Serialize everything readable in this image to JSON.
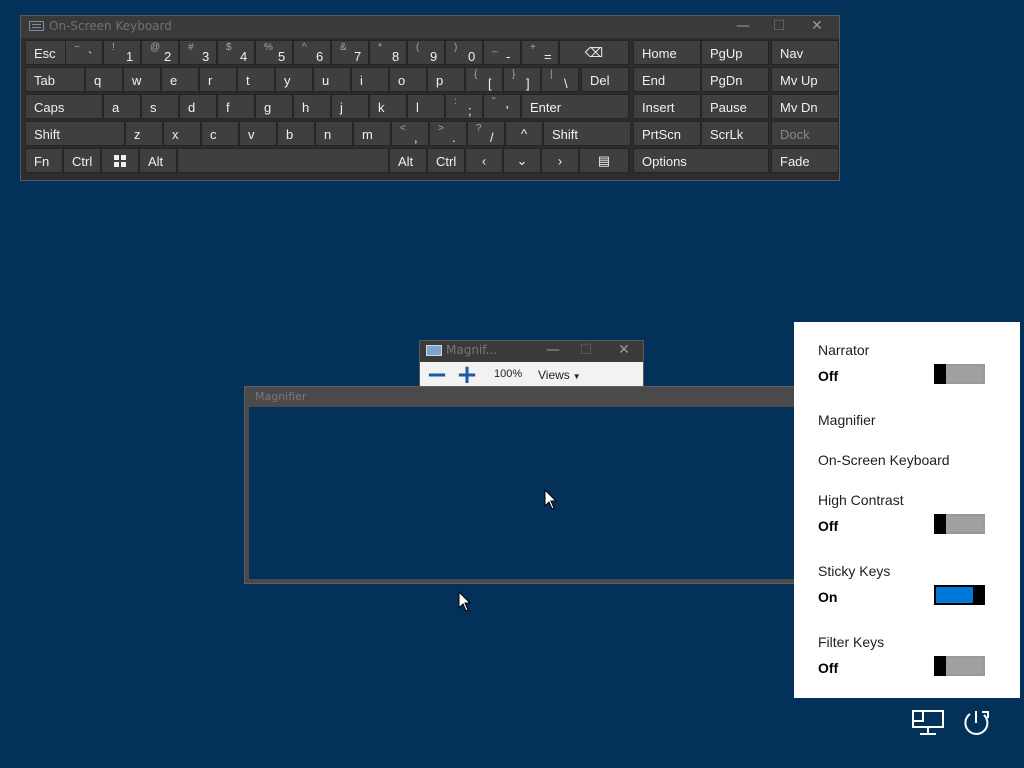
{
  "osk": {
    "title": "On-Screen Keyboard",
    "minimize": "—",
    "close": "✕",
    "rows": [
      [
        {
          "n": "esc",
          "l": "Esc"
        },
        {
          "n": "backtick",
          "t": "~",
          "b": "`"
        },
        {
          "n": "1",
          "t": "!",
          "b": "1"
        },
        {
          "n": "2",
          "t": "@",
          "b": "2"
        },
        {
          "n": "3",
          "t": "#",
          "b": "3"
        },
        {
          "n": "4",
          "t": "$",
          "b": "4"
        },
        {
          "n": "5",
          "t": "%",
          "b": "5"
        },
        {
          "n": "6",
          "t": "^",
          "b": "6"
        },
        {
          "n": "7",
          "t": "&",
          "b": "7"
        },
        {
          "n": "8",
          "t": "*",
          "b": "8"
        },
        {
          "n": "9",
          "t": "(",
          "b": "9"
        },
        {
          "n": "0",
          "t": ")",
          "b": "0"
        },
        {
          "n": "minus",
          "t": "_",
          "b": "-"
        },
        {
          "n": "equals",
          "t": "+",
          "b": "="
        },
        {
          "n": "backspace",
          "icon": "⌫"
        },
        {
          "n": "home",
          "l": "Home"
        },
        {
          "n": "pgup",
          "l": "PgUp"
        },
        {
          "n": "nav",
          "l": "Nav"
        }
      ],
      [
        {
          "n": "tab",
          "l": "Tab"
        },
        {
          "n": "q",
          "l": "q"
        },
        {
          "n": "w",
          "l": "w"
        },
        {
          "n": "e",
          "l": "e"
        },
        {
          "n": "r",
          "l": "r"
        },
        {
          "n": "t",
          "l": "t"
        },
        {
          "n": "y",
          "l": "y"
        },
        {
          "n": "u",
          "l": "u"
        },
        {
          "n": "i",
          "l": "i"
        },
        {
          "n": "o",
          "l": "o"
        },
        {
          "n": "p",
          "l": "p"
        },
        {
          "n": "lbracket",
          "t": "{",
          "b": "["
        },
        {
          "n": "rbracket",
          "t": "}",
          "b": "]"
        },
        {
          "n": "backslash",
          "t": "|",
          "b": "\\"
        },
        {
          "n": "del",
          "l": "Del"
        },
        {
          "n": "end",
          "l": "End"
        },
        {
          "n": "pgdn",
          "l": "PgDn"
        },
        {
          "n": "mvup",
          "l": "Mv Up"
        }
      ],
      [
        {
          "n": "caps",
          "l": "Caps"
        },
        {
          "n": "a",
          "l": "a"
        },
        {
          "n": "s",
          "l": "s"
        },
        {
          "n": "d",
          "l": "d"
        },
        {
          "n": "f",
          "l": "f"
        },
        {
          "n": "g",
          "l": "g"
        },
        {
          "n": "h",
          "l": "h"
        },
        {
          "n": "j",
          "l": "j"
        },
        {
          "n": "k",
          "l": "k"
        },
        {
          "n": "l",
          "l": "l"
        },
        {
          "n": "semicolon",
          "t": ":",
          "b": ";"
        },
        {
          "n": "quote",
          "t": "\"",
          "b": "'"
        },
        {
          "n": "enter",
          "l": "Enter"
        },
        {
          "n": "insert",
          "l": "Insert"
        },
        {
          "n": "pause",
          "l": "Pause"
        },
        {
          "n": "mvdn",
          "l": "Mv Dn"
        }
      ],
      [
        {
          "n": "lshift",
          "l": "Shift"
        },
        {
          "n": "z",
          "l": "z"
        },
        {
          "n": "x",
          "l": "x"
        },
        {
          "n": "c",
          "l": "c"
        },
        {
          "n": "v",
          "l": "v"
        },
        {
          "n": "b",
          "l": "b"
        },
        {
          "n": "n",
          "l": "n"
        },
        {
          "n": "m",
          "l": "m"
        },
        {
          "n": "comma",
          "t": "<",
          "b": ","
        },
        {
          "n": "period",
          "t": ">",
          "b": "."
        },
        {
          "n": "slash",
          "t": "?",
          "b": "/"
        },
        {
          "n": "up",
          "icon": "^"
        },
        {
          "n": "rshift",
          "l": "Shift"
        },
        {
          "n": "prtscn",
          "l": "PrtScn"
        },
        {
          "n": "scrlk",
          "l": "ScrLk"
        },
        {
          "n": "dock",
          "l": "Dock",
          "disabled": true
        }
      ],
      [
        {
          "n": "fn",
          "l": "Fn"
        },
        {
          "n": "lctrl",
          "l": "Ctrl"
        },
        {
          "n": "win",
          "icon": "windows-logo"
        },
        {
          "n": "lalt",
          "l": "Alt"
        },
        {
          "n": "space",
          "l": ""
        },
        {
          "n": "ralt",
          "l": "Alt"
        },
        {
          "n": "rctrl",
          "l": "Ctrl"
        },
        {
          "n": "left",
          "icon": "‹"
        },
        {
          "n": "down",
          "icon": "⌄"
        },
        {
          "n": "right",
          "icon": "›"
        },
        {
          "n": "menu",
          "icon": "▤"
        },
        {
          "n": "options",
          "l": "Options"
        },
        {
          "n": "fade",
          "l": "Fade"
        }
      ]
    ]
  },
  "magnifier": {
    "toolbar_title": "Magnif...",
    "close": "✕",
    "minus_label": "−",
    "plus_label": "+",
    "zoom": "100%",
    "views_label": "Views",
    "views_caret": "▼",
    "lens_title": "Magnifier"
  },
  "ease": {
    "items": [
      {
        "name": "Narrator",
        "state": "Off",
        "toggle": "off"
      },
      {
        "name": "Magnifier",
        "state": "",
        "toggle": "none"
      },
      {
        "name": "On-Screen Keyboard",
        "state": "",
        "toggle": "none"
      },
      {
        "name": "High Contrast",
        "state": "Off",
        "toggle": "off"
      },
      {
        "name": "Sticky Keys",
        "state": "On",
        "toggle": "on"
      },
      {
        "name": "Filter Keys",
        "state": "Off",
        "toggle": "off"
      }
    ]
  },
  "tray": {
    "network_icon": "network-icon",
    "power_icon": "power-icon"
  },
  "colors": {
    "desktop": "#03315a",
    "accent": "#0078d7",
    "key": "#3f3f3f"
  }
}
